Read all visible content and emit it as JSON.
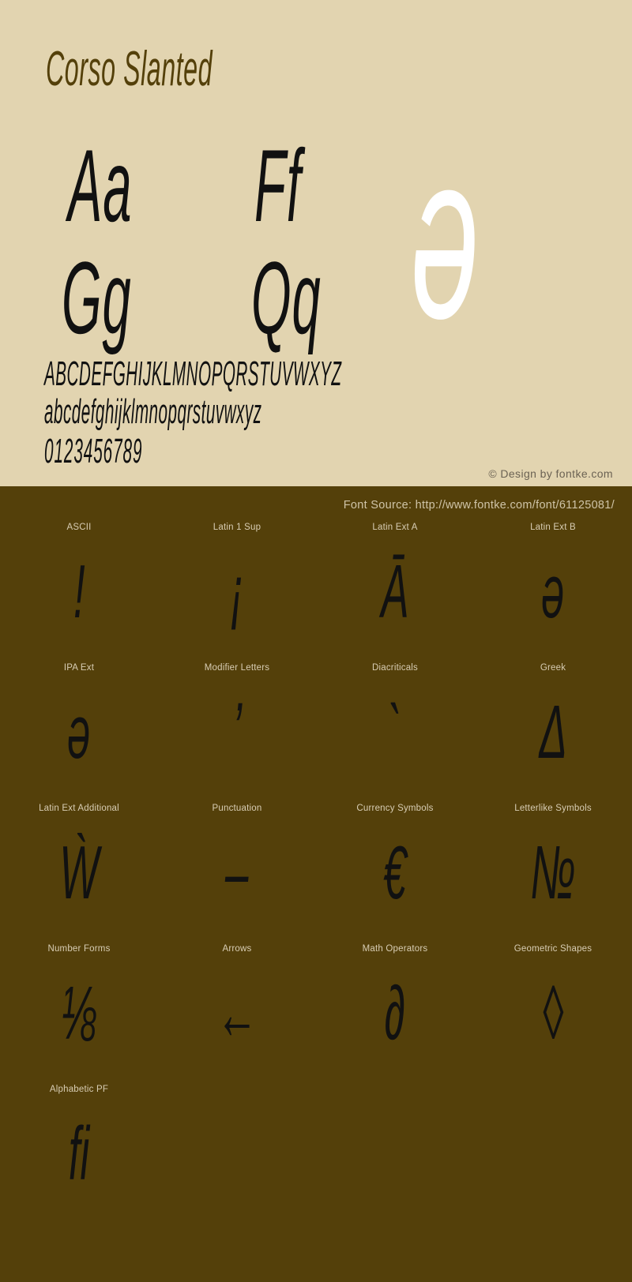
{
  "specimen": {
    "title": "Corso Slanted",
    "glyph_pairs": [
      "Aa",
      "Ff",
      "Gg",
      "Qq"
    ],
    "hero_glyph": "ə",
    "uppercase": "ABCDEFGHIJKLMNOPQRSTUVWXYZ",
    "lowercase": "abcdefghijklmnopqrstuvwxyz",
    "digits": "0123456789",
    "copyright": "© Design by fontke.com",
    "background_color": "#e2d4b0",
    "text_color": "#111111",
    "title_color": "#54400a",
    "hero_color": "#ffffff"
  },
  "blocks_panel": {
    "source": "Font Source: http://www.fontke.com/font/61125081/",
    "background_color": "#54400a",
    "label_color": "#d8cdb4",
    "glyph_color": "#111111",
    "rows": [
      [
        {
          "label": "ASCII",
          "glyph": "!"
        },
        {
          "label": "Latin 1 Sup",
          "glyph": "¡"
        },
        {
          "label": "Latin Ext A",
          "glyph": "Ā"
        },
        {
          "label": "Latin Ext B",
          "glyph": "ə"
        }
      ],
      [
        {
          "label": "IPA Ext",
          "glyph": "ə"
        },
        {
          "label": "Modifier Letters",
          "glyph": "ʼ"
        },
        {
          "label": "Diacriticals",
          "glyph": "`"
        },
        {
          "label": "Greek",
          "glyph": "Δ"
        }
      ],
      [
        {
          "label": "Latin Ext Additional",
          "glyph": "Ẁ"
        },
        {
          "label": "Punctuation",
          "glyph": "–"
        },
        {
          "label": "Currency Symbols",
          "glyph": "€"
        },
        {
          "label": "Letterlike Symbols",
          "glyph": "№"
        }
      ],
      [
        {
          "label": "Number Forms",
          "glyph": "⅛"
        },
        {
          "label": "Arrows",
          "glyph": "←"
        },
        {
          "label": "Math Operators",
          "glyph": "∂"
        },
        {
          "label": "Geometric Shapes",
          "glyph": "◊"
        }
      ],
      [
        {
          "label": "Alphabetic PF",
          "glyph": "ﬁ"
        }
      ]
    ]
  }
}
